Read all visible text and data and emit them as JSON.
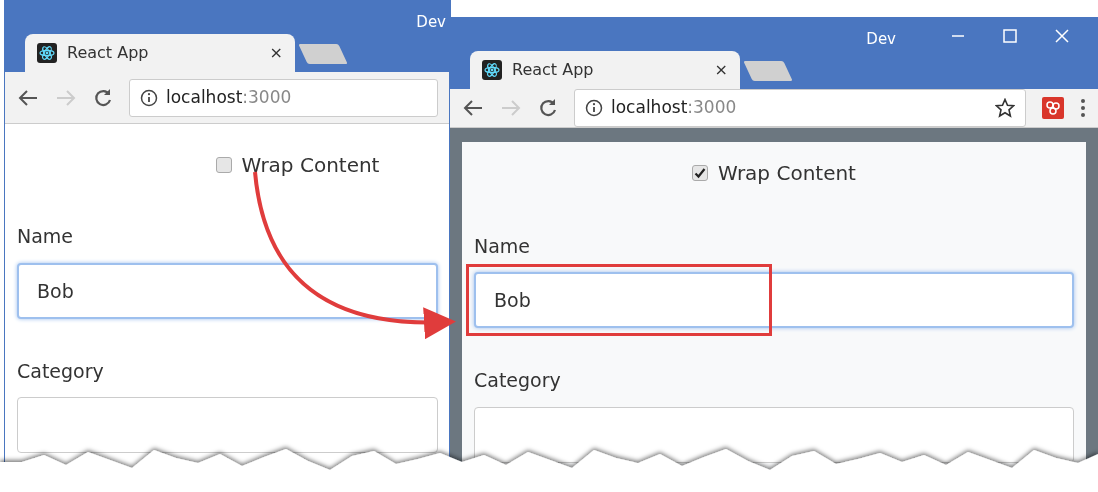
{
  "windows": [
    {
      "profile": "Dev",
      "tab": {
        "title": "React App",
        "close": "×"
      },
      "address": {
        "host": "localhost",
        "port": ":3000"
      },
      "toolbar_extras": false,
      "framed": false,
      "form": {
        "checkbox": {
          "label": "Wrap Content",
          "checked": false
        },
        "fields": [
          {
            "label": "Name",
            "value": "Bob",
            "highlighted": false
          },
          {
            "label": "Category",
            "highlighted": false
          }
        ]
      }
    },
    {
      "profile": "Dev",
      "tab": {
        "title": "React App",
        "close": "×"
      },
      "address": {
        "host": "localhost",
        "port": ":3000"
      },
      "toolbar_extras": true,
      "framed": true,
      "form": {
        "checkbox": {
          "label": "Wrap Content",
          "checked": true
        },
        "fields": [
          {
            "label": "Name",
            "value": "Bob",
            "highlighted": true
          },
          {
            "label": "Category",
            "highlighted": false
          }
        ]
      }
    }
  ]
}
